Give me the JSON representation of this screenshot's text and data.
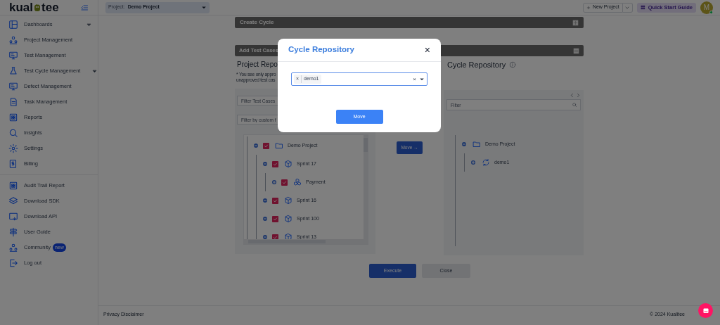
{
  "sidebar": {
    "logo_left": "kual",
    "logo_right": "tee",
    "groups": [
      [
        {
          "label": "Dashboards",
          "kind": "dashboard",
          "has_caret": true
        },
        {
          "label": "Project Management",
          "kind": "people"
        },
        {
          "label": "Test Management",
          "kind": "monitor"
        },
        {
          "label": "Test Cycle Management",
          "kind": "flask",
          "has_caret": true
        },
        {
          "label": "Defect Management",
          "kind": "monitor"
        },
        {
          "label": "Task Management",
          "kind": "document"
        },
        {
          "label": "Reports",
          "kind": "grid"
        },
        {
          "label": "Insights",
          "kind": "search"
        },
        {
          "label": "Settings",
          "kind": "gear"
        },
        {
          "label": "Billing",
          "kind": "billing"
        }
      ],
      [
        {
          "label": "Audit Trail Report",
          "kind": "grid"
        },
        {
          "label": "Download SDK",
          "kind": "layers"
        },
        {
          "label": "Download API",
          "kind": "download"
        },
        {
          "label": "User Guide",
          "kind": "signpost"
        },
        {
          "label": "Community",
          "kind": "people",
          "badge": "new"
        },
        {
          "label": "Log out",
          "kind": "logout"
        }
      ]
    ]
  },
  "topbar": {
    "project_label": "Project:",
    "project_value": "Demo Project",
    "new_project": "New Project",
    "quick_start": "Quick Start Guide",
    "avatar": "M"
  },
  "create_cycle": {
    "title": "Create Cycle"
  },
  "add_test_cases": {
    "title": "Add Test Cases",
    "left_heading": "Project Repo",
    "note_lines": [
      "* You see only appro",
      "unapproved test cas"
    ],
    "filter_placeholder": "Filter Test Cases",
    "custom_filter_placeholder": "Filter by custom f",
    "left_tree": [
      {
        "label": "Demo Project",
        "kind": "folder",
        "checked": true,
        "expanded": true,
        "children": [
          {
            "label": "Sprint 17",
            "kind": "cycle",
            "checked": true,
            "expanded": true,
            "children": [
              {
                "label": "Payment",
                "kind": "module",
                "checked": true,
                "expanded": false
              }
            ]
          },
          {
            "label": "Sprint 16",
            "kind": "cycle",
            "checked": true,
            "expanded": true
          },
          {
            "label": "Sprint 100",
            "kind": "cycle",
            "checked": true,
            "expanded": true
          },
          {
            "label": "Sprint 13",
            "kind": "cycle",
            "checked": true,
            "expanded": true
          }
        ]
      }
    ],
    "move_button": "Move →",
    "right_heading": "Cycle Repository",
    "right_filter_placeholder": "Filter",
    "right_tree": [
      {
        "label": "Demo Project",
        "kind": "folder",
        "expanded": true,
        "children": [
          {
            "label": "demo1",
            "kind": "repo",
            "expanded": false
          }
        ]
      }
    ],
    "execute": "Execute",
    "close": "Close"
  },
  "footer": {
    "privacy": "Privacy Disclaimer",
    "copyright": "© 2024 Kualitee"
  },
  "modal": {
    "title": "Cycle Repository",
    "close": "×",
    "chips": [
      {
        "remove": "×",
        "label": "demo1"
      }
    ],
    "clear": "×",
    "move": "Move"
  }
}
